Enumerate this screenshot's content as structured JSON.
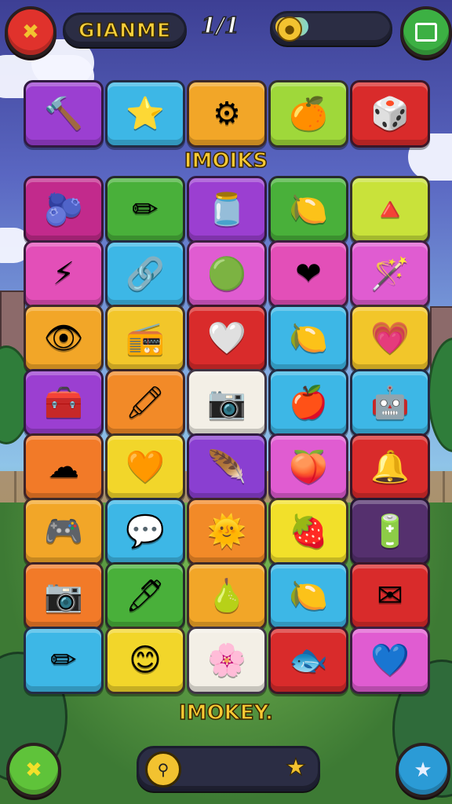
{
  "header": {
    "title": "GIANME",
    "score": "1/1",
    "progress": 0.3,
    "close_icon": "x-icon",
    "menu_icon": "panel-icon"
  },
  "labels": {
    "middle": "IMOIKS",
    "bottom": "IMOKEY."
  },
  "tiles": [
    [
      {
        "icon": "hammer-box",
        "glyph": "🔨",
        "color": "#9b3fd1"
      },
      {
        "icon": "star",
        "glyph": "⭐",
        "color": "#3db7e6"
      },
      {
        "icon": "gear",
        "glyph": "⚙",
        "color": "#f2a628"
      },
      {
        "icon": "orange",
        "glyph": "🍊",
        "color": "#9fd83a"
      },
      {
        "icon": "dice",
        "glyph": "🎲",
        "color": "#d92b2b"
      }
    ],
    [
      {
        "icon": "blueberry",
        "glyph": "🫐",
        "color": "#c22a8c"
      },
      {
        "icon": "pencil",
        "glyph": "✏",
        "color": "#49b03a"
      },
      {
        "icon": "jar",
        "glyph": "🫙",
        "color": "#9b3fd1"
      },
      {
        "icon": "lemon-face",
        "glyph": "🍋",
        "color": "#49b03a"
      },
      {
        "icon": "cone",
        "glyph": "🔺",
        "color": "#c9e23a"
      }
    ],
    [
      {
        "icon": "bolt",
        "glyph": "⚡",
        "color": "#e34fb8"
      },
      {
        "icon": "rings",
        "glyph": "🔗",
        "color": "#3db7e6"
      },
      {
        "icon": "ball",
        "glyph": "🟢",
        "color": "#e05cd1"
      },
      {
        "icon": "heart",
        "glyph": "❤",
        "color": "#e34fb8"
      },
      {
        "icon": "wand",
        "glyph": "🪄",
        "color": "#e05cd1"
      }
    ],
    [
      {
        "icon": "eye-device",
        "glyph": "👁",
        "color": "#f2a628"
      },
      {
        "icon": "radio",
        "glyph": "📻",
        "color": "#f2c62a"
      },
      {
        "icon": "heart",
        "glyph": "🤍",
        "color": "#d92b2b"
      },
      {
        "icon": "lemon",
        "glyph": "🍋",
        "color": "#3db7e6"
      },
      {
        "icon": "heart",
        "glyph": "💗",
        "color": "#f2c62a"
      }
    ],
    [
      {
        "icon": "toolbox",
        "glyph": "🧰",
        "color": "#9b3fd1"
      },
      {
        "icon": "marker",
        "glyph": "🖍",
        "color": "#f28a28"
      },
      {
        "icon": "camera",
        "glyph": "📷",
        "color": "#f3efe6"
      },
      {
        "icon": "apple",
        "glyph": "🍎",
        "color": "#3db7e6"
      },
      {
        "icon": "robot-box",
        "glyph": "🤖",
        "color": "#3db7e6"
      }
    ],
    [
      {
        "icon": "cloud",
        "glyph": "☁",
        "color": "#f27a28"
      },
      {
        "icon": "heart",
        "glyph": "🧡",
        "color": "#f2d62a"
      },
      {
        "icon": "feather",
        "glyph": "🪶",
        "color": "#8a3fd1"
      },
      {
        "icon": "plum",
        "glyph": "🍑",
        "color": "#e05cd1"
      },
      {
        "icon": "bell",
        "glyph": "🔔",
        "color": "#d92b2b"
      }
    ],
    [
      {
        "icon": "gamepad",
        "glyph": "🎮",
        "color": "#f2a628"
      },
      {
        "icon": "chat-bubble",
        "glyph": "💬",
        "color": "#3db7e6"
      },
      {
        "icon": "sun-face",
        "glyph": "🌞",
        "color": "#f28a28"
      },
      {
        "icon": "strawberry",
        "glyph": "🍓",
        "color": "#f2e02a"
      },
      {
        "icon": "battery",
        "glyph": "🔋",
        "color": "#55306e"
      }
    ],
    [
      {
        "icon": "camera",
        "glyph": "📷",
        "color": "#f27a28"
      },
      {
        "icon": "marker",
        "glyph": "🖊",
        "color": "#49b03a"
      },
      {
        "icon": "pear",
        "glyph": "🍐",
        "color": "#f2a628"
      },
      {
        "icon": "lemon",
        "glyph": "🍋",
        "color": "#3db7e6"
      },
      {
        "icon": "envelope",
        "glyph": "✉",
        "color": "#d92b2b"
      }
    ],
    [
      {
        "icon": "pencil",
        "glyph": "✏",
        "color": "#3db7e6"
      },
      {
        "icon": "smiley-star",
        "glyph": "😊",
        "color": "#f2d62a"
      },
      {
        "icon": "leaf-flower",
        "glyph": "🌸",
        "color": "#f3efe6"
      },
      {
        "icon": "fish",
        "glyph": "🐟",
        "color": "#d92b2b"
      },
      {
        "icon": "heart-bubble",
        "glyph": "💙",
        "color": "#e05cd1"
      }
    ]
  ],
  "footer": {
    "left_icon": "x-icon",
    "right_icon": "star-badge-icon",
    "search_icon": "magnifier-icon",
    "star_icon": "star-icon"
  }
}
